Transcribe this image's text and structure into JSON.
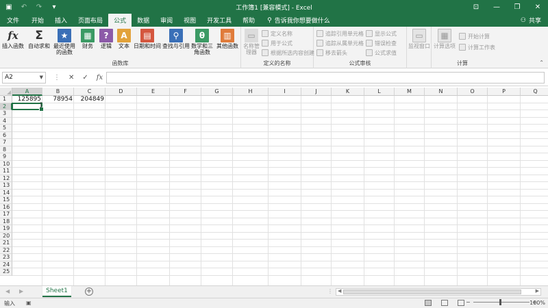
{
  "titlebar": {
    "title": "工作簿1 [兼容模式] - Excel",
    "share_label": "共享",
    "tell_me": "告诉我你想要做什么"
  },
  "tabs": [
    {
      "label": "文件"
    },
    {
      "label": "开始"
    },
    {
      "label": "插入"
    },
    {
      "label": "页面布局"
    },
    {
      "label": "公式",
      "active": true
    },
    {
      "label": "数据"
    },
    {
      "label": "审阅"
    },
    {
      "label": "视图"
    },
    {
      "label": "开发工具"
    },
    {
      "label": "帮助"
    }
  ],
  "ribbon": {
    "function_library": {
      "label": "函数库",
      "buttons": [
        {
          "label": "插入函数",
          "icon": "fx-icon"
        },
        {
          "label": "自动求和",
          "icon": "sigma-icon"
        },
        {
          "label": "最近使用的函数",
          "icon": "star-book-icon"
        },
        {
          "label": "财务",
          "icon": "finance-book-icon"
        },
        {
          "label": "逻辑",
          "icon": "question-book-icon"
        },
        {
          "label": "文本",
          "icon": "text-book-icon"
        },
        {
          "label": "日期和时间",
          "icon": "calendar-book-icon"
        },
        {
          "label": "查找与引用",
          "icon": "search-book-icon"
        },
        {
          "label": "数学和三角函数",
          "icon": "theta-book-icon"
        },
        {
          "label": "其他函数",
          "icon": "more-book-icon"
        }
      ]
    },
    "defined_names": {
      "label": "定义的名称",
      "name_manager": "名称管理器",
      "define_name": "定义名称",
      "use_in_formula": "用于公式",
      "create_from_selection": "根据所选内容创建"
    },
    "formula_auditing": {
      "label": "公式审核",
      "trace_precedents": "追踪引用单元格",
      "trace_dependents": "追踪从属单元格",
      "remove_arrows": "移去箭头",
      "show_formulas": "显示公式",
      "error_checking": "错误检查",
      "evaluate_formula": "公式求值",
      "watch_window": "监视窗口"
    },
    "calculation": {
      "label": "计算",
      "calc_options": "计算选项",
      "calc_now": "开始计算",
      "calc_sheet": "计算工作表"
    }
  },
  "formula_bar": {
    "name_box": "A2",
    "formula": "",
    "cancel_glyph": "✕",
    "enter_glyph": "✓",
    "fx_glyph": "fx"
  },
  "grid": {
    "columns": [
      "A",
      "B",
      "C",
      "D",
      "E",
      "F",
      "G",
      "H",
      "I",
      "J",
      "K",
      "L",
      "M",
      "N",
      "O",
      "P",
      "Q"
    ],
    "rows": [
      "1",
      "2",
      "3",
      "4",
      "5",
      "6",
      "7",
      "8",
      "9",
      "10",
      "11",
      "12",
      "13",
      "14",
      "15",
      "16",
      "17",
      "18",
      "19",
      "20",
      "21",
      "22",
      "23",
      "24",
      "25"
    ],
    "cells": {
      "A1": "125895",
      "B1": "78954",
      "C1": "204849"
    },
    "selected": "A2"
  },
  "sheets": [
    {
      "label": "Sheet1",
      "active": true
    }
  ],
  "status": {
    "mode": "输入",
    "zoom": "100%"
  },
  "colors": {
    "brand": "#217346"
  }
}
